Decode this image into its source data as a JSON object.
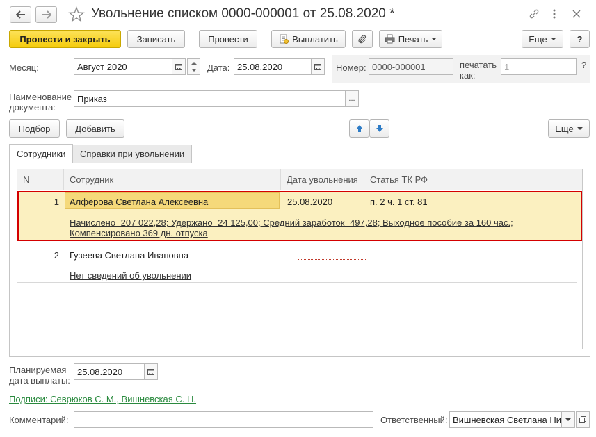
{
  "window": {
    "title": "Увольнение списком 0000-000001 от 25.08.2020 *"
  },
  "toolbar": {
    "post_close": "Провести и закрыть",
    "save": "Записать",
    "post": "Провести",
    "pay": "Выплатить",
    "print": "Печать",
    "more": "Еще",
    "help": "?"
  },
  "header": {
    "month_label": "Месяц:",
    "month_value": "Август 2020",
    "date_label": "Дата:",
    "date_value": "25.08.2020",
    "number_label": "Номер:",
    "number_value": "0000-000001",
    "print_as_label": "печатать как:",
    "print_as_placeholder": "1",
    "docname_label": "Наименование документа:",
    "docname_value": "Приказ"
  },
  "table_toolbar": {
    "pick": "Подбор",
    "add": "Добавить",
    "more": "Еще"
  },
  "tabs": [
    {
      "label": "Сотрудники"
    },
    {
      "label": "Справки при увольнении"
    }
  ],
  "table": {
    "columns": [
      "N",
      "Сотрудник",
      "Дата увольнения",
      "Статья ТК РФ"
    ],
    "rows": [
      {
        "n": "1",
        "employee": "Алфёрова Светлана Алексеевна",
        "date": "25.08.2020",
        "article": "п. 2 ч. 1 ст. 81",
        "details_line1": "Начислено=207 022,28; Удержано=24 125,00; Средний заработок=497,28; Выходное пособие за 160 час.;",
        "details_line2": "Компенсировано 369 дн. отпуска"
      },
      {
        "n": "2",
        "employee": "Гузеева Светлана Ивановна",
        "date": "",
        "article": "",
        "details_line1": "Нет сведений об увольнении",
        "details_line2": ""
      }
    ]
  },
  "footer": {
    "pay_date_label": "Планируемая дата выплаты:",
    "pay_date_value": "25.08.2020",
    "signatures_link": "Подписи: Севрюков С. М., Вишневская С. Н.",
    "comment_label": "Комментарий:",
    "comment_value": "",
    "responsible_label": "Ответственный:",
    "responsible_value": "Вишневская Светлана Ни"
  },
  "colors": {
    "primary_button": "#f5cc0d",
    "selected_row": "#fbf0c0",
    "selected_cell": "#f5d97a",
    "selection_border": "#d40000",
    "link_green": "#2a8a3e",
    "arrow_blue": "#2e7cc6"
  }
}
